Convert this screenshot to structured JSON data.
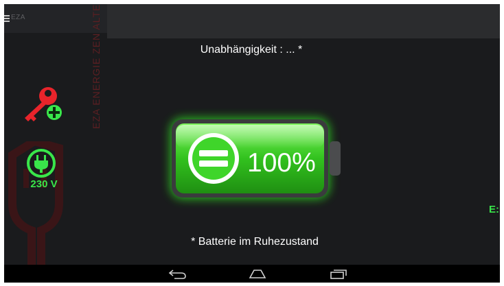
{
  "app": {
    "title": "EZA",
    "watermark": "EZA ENERGIE ZEN ALTERNATIVE"
  },
  "main": {
    "independence_label": "Unabhängigkeit :  ... *",
    "battery_percent": "100%",
    "battery_level": 1.0,
    "battery_status": "* Batterie im Ruhezustand"
  },
  "sidebar": {
    "key_icon": "key-add-icon",
    "grid_label": "230 V",
    "grid_icon": "plug-icon"
  },
  "edge": {
    "label": "E:"
  },
  "nav": {
    "back_icon": "back-icon",
    "home_icon": "home-icon",
    "recents_icon": "recents-icon"
  },
  "colors": {
    "accent_green": "#39e64a",
    "key_red": "#e8242b",
    "watermark_red": "#5c1f22",
    "background": "#1a1b1d"
  }
}
